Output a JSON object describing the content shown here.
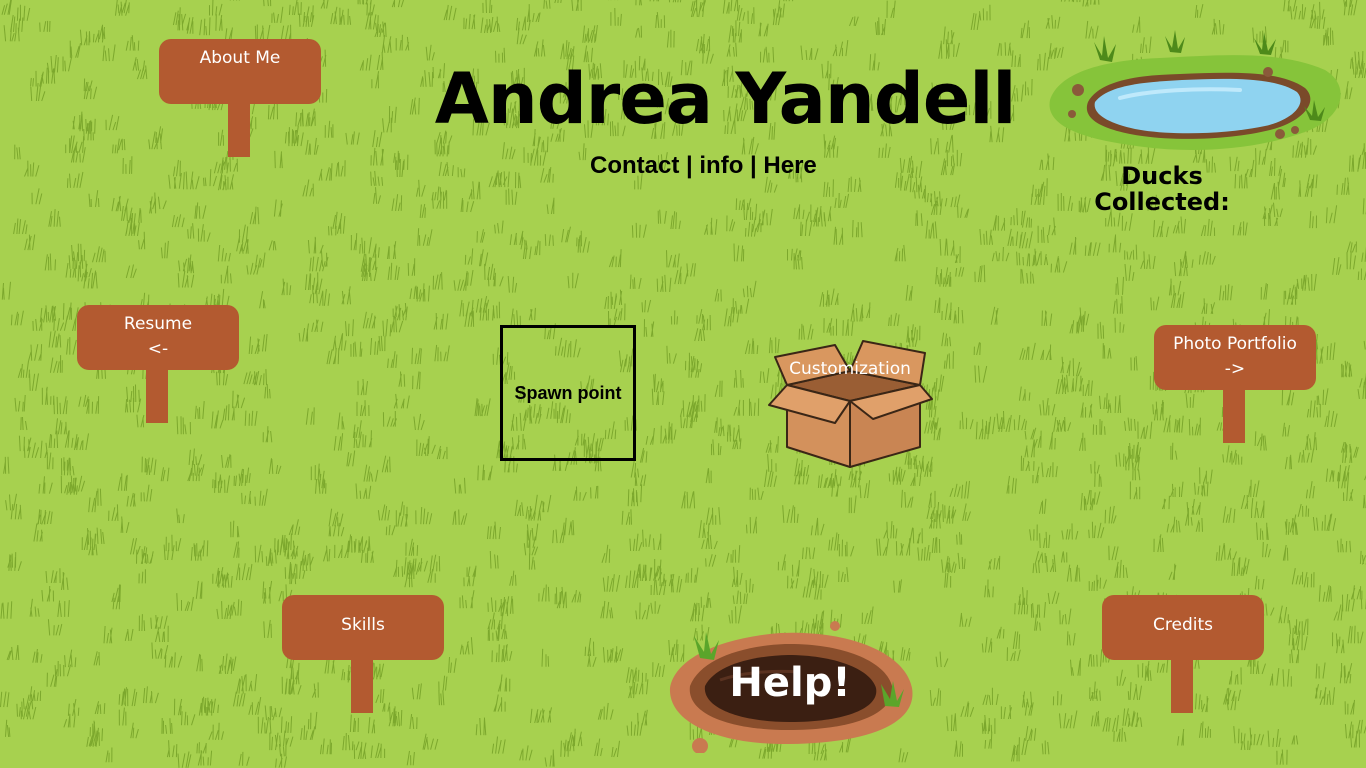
{
  "header": {
    "title": "Andrea Yandell",
    "contact": "Contact | info | Here"
  },
  "ducks": {
    "label": "Ducks\nCollected:"
  },
  "signs": {
    "about": {
      "label": "About Me"
    },
    "resume": {
      "label": "Resume\n<-"
    },
    "photo": {
      "label": "Photo Portfolio\n->"
    },
    "skills": {
      "label": "Skills"
    },
    "credits": {
      "label": "Credits"
    }
  },
  "spawn": {
    "label": "Spawn point"
  },
  "customization": {
    "label": "Customization"
  },
  "help": {
    "label": "Help!"
  },
  "colors": {
    "grass": "#a7d14f",
    "grass_blade": "#6e9a22",
    "sign": "#b35a30",
    "water": "#8fd3f0",
    "box": "#d3915c"
  }
}
